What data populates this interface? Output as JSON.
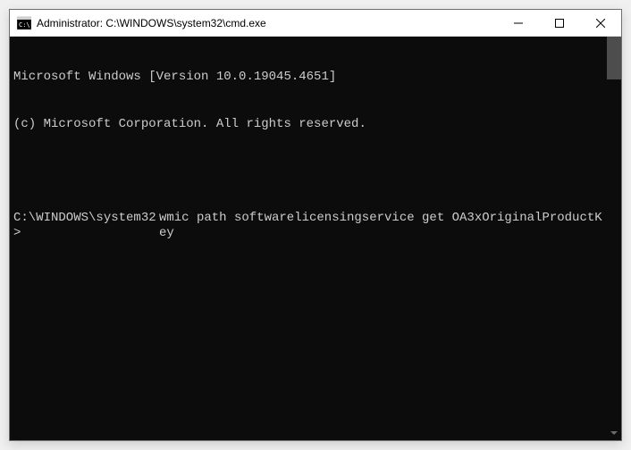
{
  "titlebar": {
    "title": "Administrator: C:\\WINDOWS\\system32\\cmd.exe"
  },
  "terminal": {
    "line1": "Microsoft Windows [Version 10.0.19045.4651]",
    "line2": "(c) Microsoft Corporation. All rights reserved.",
    "prompt": "C:\\WINDOWS\\system32>",
    "command": "wmic path softwarelicensingservice get OA3xOriginalProductKey"
  }
}
